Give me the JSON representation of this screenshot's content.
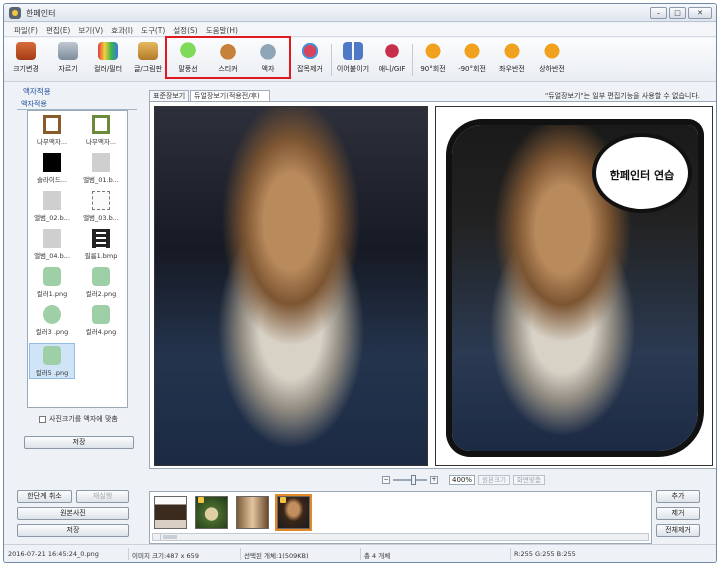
{
  "window": {
    "title": "한페인터"
  },
  "menu": [
    "파일(F)",
    "편집(E)",
    "보기(V)",
    "효과(I)",
    "도구(T)",
    "설정(S)",
    "도움말(H)"
  ],
  "toolbar": {
    "resize": "크기변경",
    "crop": "자르기",
    "color_filter": "컬러/필터",
    "text_draw": "글/그림판",
    "speech_bubble": "말풍선",
    "sticker": "스티커",
    "frame": "액자",
    "object_remove": "잡목제거",
    "join": "이어붙이기",
    "ani_gif": "애니/GIF",
    "rotate_90": "90°회전",
    "rotate_m90": "-90°회전",
    "flip_h": "좌우반전",
    "flip_v": "상하반전"
  },
  "left_panel": {
    "title": "액자적용",
    "tab": "액자적용",
    "frames": [
      "나무액자...",
      "나무액자...",
      "슬라이드...",
      "앨범_01.b...",
      "앨범_02.b...",
      "앨범_03.b...",
      "앨범_04.b...",
      "필름1.bmp",
      "컬러1.png",
      "컬러2.png",
      "컬러3 .png",
      "컬러4.png",
      "컬러5 .png"
    ],
    "selected_frame": "컬러5 .png",
    "fit_checkbox": "사진크기를 액자에 맞춤",
    "save_button": "저장"
  },
  "view_tabs": {
    "normal": "표준장보기",
    "dual": "듀얼장보기(적용전/후)"
  },
  "notice": "\"듀얼장보기\"는 일부 편집기능을 사용할 수 없습니다.",
  "preview": {
    "bubble_text": "한페인터 연습"
  },
  "zoom": {
    "value": "400%",
    "original_size": "원본크기",
    "fit_screen": "화면맞춤"
  },
  "bottom_left": {
    "undo": "한단계 취소",
    "redo": "재실행",
    "original": "원본사진",
    "save": "저장"
  },
  "bottom_right": {
    "add": "추가",
    "remove": "제거",
    "remove_all": "전체제거"
  },
  "status": {
    "file": "2016-07-21 16:45:24_0.png",
    "image_size": "이미지 크기:487 x 659",
    "selected": "선택된 개체:1(509KB)",
    "total": "총 4 개체",
    "rgb": "R:255 G:255 B:255"
  }
}
